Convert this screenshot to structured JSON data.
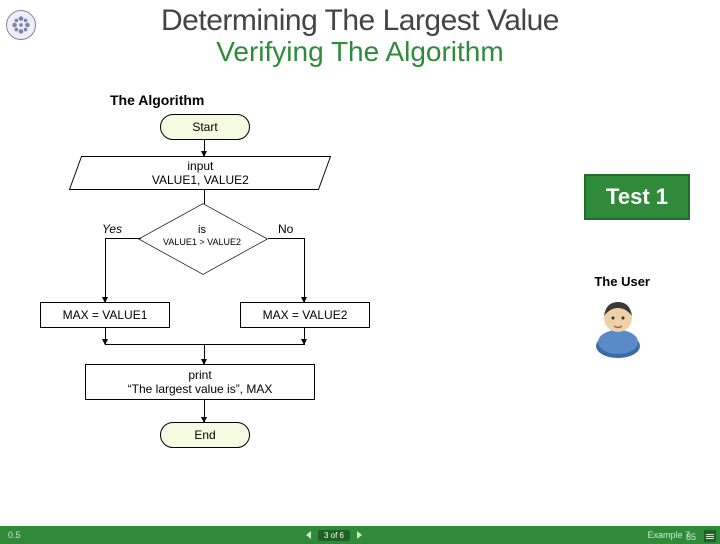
{
  "title": "Determining The Largest Value",
  "subtitle": "Verifying The Algorithm",
  "heading": "The Algorithm",
  "flow": {
    "start": "Start",
    "input_l1": "input",
    "input_l2": "VALUE1, VALUE2",
    "decision_l1": "is",
    "decision_l2": "VALUE1 > VALUE2",
    "yes": "Yes",
    "no": "No",
    "assign_left": "MAX = VALUE1",
    "assign_right": "MAX = VALUE2",
    "print_l1": "print",
    "print_l2": "“The largest value is”, MAX",
    "end": "End"
  },
  "test_badge": "Test 1",
  "user_label": "The User",
  "footer": {
    "version": "0.5",
    "progress": "3 of 6",
    "example": "Example 7",
    "page": "85"
  }
}
